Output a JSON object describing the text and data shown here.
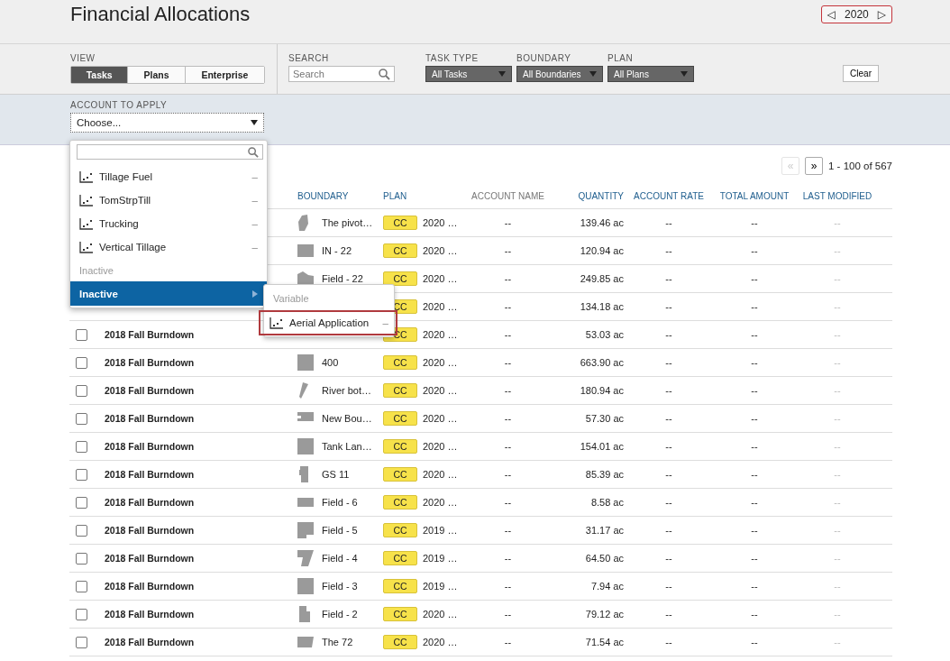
{
  "header": {
    "title": "Financial Allocations",
    "prev": "◁",
    "year": "2020",
    "next": "▷"
  },
  "filters": {
    "view": {
      "label": "VIEW",
      "options": [
        {
          "label": "Tasks",
          "selected": true
        },
        {
          "label": "Plans",
          "selected": false
        },
        {
          "label": "Enterprise",
          "selected": false
        }
      ]
    },
    "search": {
      "label": "SEARCH",
      "placeholder": "Search"
    },
    "dropdowns": [
      {
        "label": "TASK TYPE",
        "value": "All Tasks"
      },
      {
        "label": "BOUNDARY",
        "value": "All Boundaries"
      },
      {
        "label": "PLAN",
        "value": "All Plans"
      }
    ],
    "clear": "Clear"
  },
  "account": {
    "label": "ACCOUNT TO APPLY",
    "value": "Choose...",
    "menu": [
      {
        "kind": "item",
        "label": "Tillage Fuel",
        "rate": "–"
      },
      {
        "kind": "item",
        "label": "TomStrpTill",
        "rate": "–"
      },
      {
        "kind": "item",
        "label": "Trucking",
        "rate": "–"
      },
      {
        "kind": "item",
        "label": "Vertical Tillage",
        "rate": "–"
      },
      {
        "kind": "header",
        "label": "Inactive"
      },
      {
        "kind": "submenu",
        "label": "Inactive",
        "selected": true
      }
    ],
    "submenu": [
      {
        "kind": "header",
        "label": "Variable"
      },
      {
        "kind": "item",
        "label": "Aerial Application",
        "rate": "–",
        "highlighted": true
      }
    ]
  },
  "pagination": {
    "first": "«",
    "first_disabled": true,
    "next": "»",
    "range": "1 - 100 of 567"
  },
  "table": {
    "columns": [
      {
        "label": "BOUNDARY",
        "sortable": true
      },
      {
        "label": "PLAN",
        "sortable": true
      },
      {
        "label": "ACCOUNT NAME",
        "sortable": false
      },
      {
        "label": "QUANTITY",
        "sortable": true
      },
      {
        "label": "ACCOUNT RATE",
        "sortable": true
      },
      {
        "label": "TOTAL AMOUNT",
        "sortable": true
      },
      {
        "label": "LAST MODIFIED",
        "sortable": true
      }
    ],
    "rows": [
      {
        "boundary": "The pivot…",
        "plan_tag": "CC",
        "plan": "2020 …",
        "account_name": "--",
        "quantity": "139.46 ac",
        "rate": "--",
        "total": "--",
        "modified": "--"
      },
      {
        "boundary": "IN - 22",
        "plan_tag": "CC",
        "plan": "2020 …",
        "account_name": "--",
        "quantity": "120.94 ac",
        "rate": "--",
        "total": "--",
        "modified": "--"
      },
      {
        "boundary": "Field - 22",
        "plan_tag": "CC",
        "plan": "2020 …",
        "account_name": "--",
        "quantity": "249.85 ac",
        "rate": "--",
        "total": "--",
        "modified": "--"
      },
      {
        "plan_tag": "CC",
        "plan": "2020 …",
        "account_name": "--",
        "quantity": "134.18 ac",
        "rate": "--",
        "total": "--",
        "modified": "--"
      },
      {
        "name": "2018 Fall Burndown",
        "checked": false,
        "plan_tag": "CC",
        "plan": "2020 …",
        "account_name": "--",
        "quantity": "53.03 ac",
        "rate": "--",
        "total": "--",
        "modified": "--"
      },
      {
        "name": "2018 Fall Burndown",
        "checked": false,
        "boundary": "400",
        "plan_tag": "CC",
        "plan": "2020 …",
        "account_name": "--",
        "quantity": "663.90 ac",
        "rate": "--",
        "total": "--",
        "modified": "--"
      },
      {
        "name": "2018 Fall Burndown",
        "checked": false,
        "boundary": "River bot…",
        "plan_tag": "CC",
        "plan": "2020 …",
        "account_name": "--",
        "quantity": "180.94 ac",
        "rate": "--",
        "total": "--",
        "modified": "--"
      },
      {
        "name": "2018 Fall Burndown",
        "checked": false,
        "boundary": "New Bou…",
        "plan_tag": "CC",
        "plan": "2020 …",
        "account_name": "--",
        "quantity": "57.30 ac",
        "rate": "--",
        "total": "--",
        "modified": "--"
      },
      {
        "name": "2018 Fall Burndown",
        "checked": false,
        "boundary": "Tank Lan…",
        "plan_tag": "CC",
        "plan": "2020 …",
        "account_name": "--",
        "quantity": "154.01 ac",
        "rate": "--",
        "total": "--",
        "modified": "--"
      },
      {
        "name": "2018 Fall Burndown",
        "checked": false,
        "boundary": "GS 11",
        "plan_tag": "CC",
        "plan": "2020 …",
        "account_name": "--",
        "quantity": "85.39 ac",
        "rate": "--",
        "total": "--",
        "modified": "--"
      },
      {
        "name": "2018 Fall Burndown",
        "checked": false,
        "boundary": "Field - 6",
        "plan_tag": "CC",
        "plan": "2020 …",
        "account_name": "--",
        "quantity": "8.58 ac",
        "rate": "--",
        "total": "--",
        "modified": "--"
      },
      {
        "name": "2018 Fall Burndown",
        "checked": false,
        "boundary": "Field - 5",
        "plan_tag": "CC",
        "plan": "2019 …",
        "account_name": "--",
        "quantity": "31.17 ac",
        "rate": "--",
        "total": "--",
        "modified": "--"
      },
      {
        "name": "2018 Fall Burndown",
        "checked": false,
        "boundary": "Field - 4",
        "plan_tag": "CC",
        "plan": "2019 …",
        "account_name": "--",
        "quantity": "64.50 ac",
        "rate": "--",
        "total": "--",
        "modified": "--"
      },
      {
        "name": "2018 Fall Burndown",
        "checked": false,
        "boundary": "Field - 3",
        "plan_tag": "CC",
        "plan": "2019 …",
        "account_name": "--",
        "quantity": "7.94 ac",
        "rate": "--",
        "total": "--",
        "modified": "--"
      },
      {
        "name": "2018 Fall Burndown",
        "checked": false,
        "boundary": "Field - 2",
        "plan_tag": "CC",
        "plan": "2020 …",
        "account_name": "--",
        "quantity": "79.12 ac",
        "rate": "--",
        "total": "--",
        "modified": "--"
      },
      {
        "name": "2018 Fall Burndown",
        "checked": false,
        "boundary": "The 72",
        "plan_tag": "CC",
        "plan": "2020 …",
        "account_name": "--",
        "quantity": "71.54 ac",
        "rate": "--",
        "total": "--",
        "modified": "--"
      }
    ]
  }
}
